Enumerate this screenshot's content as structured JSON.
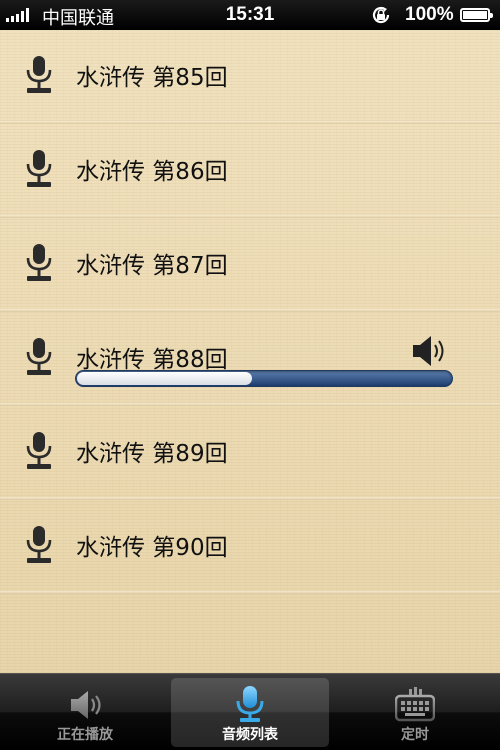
{
  "status_bar": {
    "carrier": "中国联通",
    "time": "15:31",
    "battery": "100%"
  },
  "list": {
    "items": [
      {
        "title": "水浒传 第85回"
      },
      {
        "title": "水浒传 第86回"
      },
      {
        "title": "水浒传 第87回"
      },
      {
        "title": "水浒传 第88回",
        "playing": true,
        "progress_percent": 47
      },
      {
        "title": "水浒传 第89回"
      },
      {
        "title": "水浒传 第90回"
      }
    ]
  },
  "tab_bar": {
    "tabs": [
      {
        "label": "正在播放",
        "icon": "speaker-icon"
      },
      {
        "label": "音频列表",
        "icon": "microphone-icon",
        "active": true
      },
      {
        "label": "定时",
        "icon": "keypad-timer-icon"
      }
    ]
  },
  "colors": {
    "background": "#eddcb6",
    "progress_track": "#1d3d6f",
    "tab_active_icon": "#3aa9e8"
  }
}
